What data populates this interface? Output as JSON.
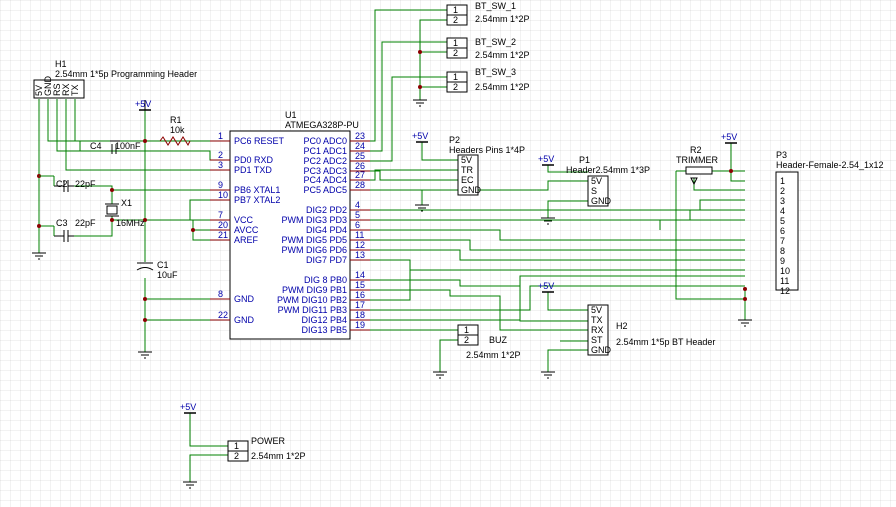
{
  "h1": {
    "ref": "H1",
    "desc": "2.54mm 1*5p Programming Header",
    "pins": [
      "5V",
      "GND",
      "RS",
      "RX",
      "TX"
    ]
  },
  "r1": {
    "ref": "R1",
    "value": "10k"
  },
  "c4": {
    "ref": "C4",
    "value": "100nF"
  },
  "c2": {
    "ref": "C2",
    "value": "22pF"
  },
  "c3": {
    "ref": "C3",
    "value": "22pF"
  },
  "x1": {
    "ref": "X1",
    "value": "16MHz"
  },
  "c1": {
    "ref": "C1",
    "value": "10uF"
  },
  "power_label": "+5V",
  "u1": {
    "ref": "U1",
    "part": "ATMEGA328P-PU",
    "left": [
      {
        "num": "1",
        "name": "PC6 RESET"
      },
      {
        "num": "2",
        "name": "PD0 RXD"
      },
      {
        "num": "3",
        "name": "PD1 TXD"
      },
      {
        "num": "9",
        "name": "PB6 XTAL1"
      },
      {
        "num": "10",
        "name": "PB7 XTAL2"
      },
      {
        "num": "7",
        "name": "VCC"
      },
      {
        "num": "20",
        "name": "AVCC"
      },
      {
        "num": "21",
        "name": "AREF"
      },
      {
        "num": "8",
        "name": "GND"
      },
      {
        "num": "22",
        "name": "GND"
      }
    ],
    "right": [
      {
        "num": "23",
        "name": "PC0 ADC0"
      },
      {
        "num": "24",
        "name": "PC1 ADC1"
      },
      {
        "num": "25",
        "name": "PC2 ADC2"
      },
      {
        "num": "26",
        "name": "PC3 ADC3"
      },
      {
        "num": "27",
        "name": "PC4 ADC4"
      },
      {
        "num": "28",
        "name": "PC5 ADC5"
      },
      {
        "num": "4",
        "name": "DIG2 PD2"
      },
      {
        "num": "5",
        "name": "PWM DIG3 PD3"
      },
      {
        "num": "6",
        "name": "DIG4 PD4"
      },
      {
        "num": "11",
        "name": "PWM DIG5 PD5"
      },
      {
        "num": "12",
        "name": "PWM DIG6 PD6"
      },
      {
        "num": "13",
        "name": "DIG7 PD7"
      },
      {
        "num": "14",
        "name": "DIG 8 PB0"
      },
      {
        "num": "15",
        "name": "PWM DIG9 PB1"
      },
      {
        "num": "16",
        "name": "PWM DIG10 PB2"
      },
      {
        "num": "17",
        "name": "PWM DIG11 PB3"
      },
      {
        "num": "18",
        "name": "DIG12 PB4"
      },
      {
        "num": "19",
        "name": "DIG13 PB5"
      }
    ]
  },
  "bt_sw_1": {
    "ref": "BT_SW_1",
    "desc": "2.54mm 1*2P",
    "pins": [
      "1",
      "2"
    ]
  },
  "bt_sw_2": {
    "ref": "BT_SW_2",
    "desc": "2.54mm 1*2P",
    "pins": [
      "1",
      "2"
    ]
  },
  "bt_sw_3": {
    "ref": "BT_SW_3",
    "desc": "2.54mm 1*2P",
    "pins": [
      "1",
      "2"
    ]
  },
  "p2": {
    "ref": "P2",
    "desc": "Headers  Pins 1*4P",
    "pins": [
      "5V",
      "TR",
      "EC",
      "GND"
    ]
  },
  "p1": {
    "ref": "P1",
    "desc": "Header2.54mm 1*3P",
    "pins": [
      "5V",
      "S",
      "GND"
    ]
  },
  "r2": {
    "ref": "R2",
    "desc": "TRIMMER"
  },
  "p3": {
    "ref": "P3",
    "desc": "Header-Female-2.54_1x12",
    "pins": [
      "1",
      "2",
      "3",
      "4",
      "5",
      "6",
      "7",
      "8",
      "9",
      "10",
      "11",
      "12"
    ]
  },
  "h2": {
    "ref": "H2",
    "desc": "2.54mm 1*5p BT Header",
    "pins": [
      "5V",
      "TX",
      "RX",
      "ST",
      "GND"
    ]
  },
  "buz": {
    "ref": "BUZ",
    "desc": "2.54mm 1*2P",
    "pins": [
      "1",
      "2"
    ]
  },
  "power": {
    "ref": "POWER",
    "desc": "2.54mm 1*2P",
    "pins": [
      "1",
      "2"
    ]
  }
}
